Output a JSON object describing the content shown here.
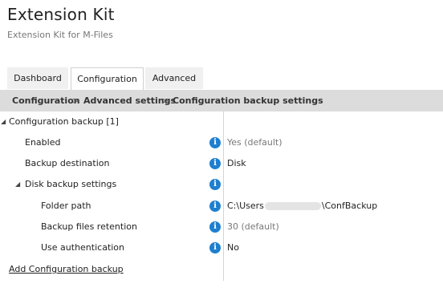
{
  "app": {
    "title": "Extension Kit",
    "subtitle": "Extension Kit for M-Files"
  },
  "tabs": [
    {
      "label": "Dashboard",
      "active": false
    },
    {
      "label": "Configuration",
      "active": true
    },
    {
      "label": "Advanced",
      "active": false
    }
  ],
  "breadcrumb": {
    "items": [
      "Configuration",
      "Advanced settings",
      "Configuration backup settings"
    ],
    "separator": ">"
  },
  "tree": {
    "group": {
      "label": "Configuration backup [1]",
      "expanded": true
    },
    "enabled": {
      "label": "Enabled",
      "value": "Yes (default)"
    },
    "backup_destination": {
      "label": "Backup destination",
      "value": "Disk"
    },
    "disk_settings": {
      "label": "Disk backup settings",
      "expanded": true
    },
    "folder_path": {
      "label": "Folder path",
      "value_prefix": "C:\\Users",
      "value_suffix": "\\ConfBackup"
    },
    "retention": {
      "label": "Backup files retention",
      "value": "30 (default)"
    },
    "use_auth": {
      "label": "Use authentication",
      "value": "No"
    },
    "add_link": "Add Configuration backup"
  },
  "icons": {
    "info": "info-icon",
    "expand": "triangle-down-icon"
  },
  "colors": {
    "info_icon": "#1e7fd0",
    "breadcrumb_bg": "#dcdcdc",
    "muted_text": "#777777"
  }
}
